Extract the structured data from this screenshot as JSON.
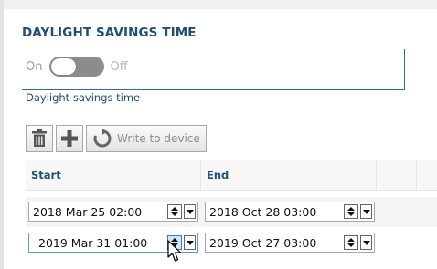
{
  "section": {
    "title": "DAYLIGHT SAVINGS TIME"
  },
  "toggle": {
    "on_label": "On",
    "off_label": "Off",
    "caption": "Daylight savings time",
    "state": "off"
  },
  "toolbar": {
    "delete_icon": "trash-icon",
    "add_icon": "plus-icon",
    "write_label": "Write to device",
    "write_icon": "sync-icon"
  },
  "table": {
    "columns": [
      "Start",
      "End"
    ],
    "rows": [
      {
        "start": "2018 Mar 25 02:00",
        "end": "2018 Oct 28 03:00"
      },
      {
        "start": "2019 Mar 31 01:00",
        "end": "2019 Oct 27 03:00"
      }
    ]
  },
  "colors": {
    "accent": "#1f4e79",
    "border_accent": "#2e6da4",
    "toggle_off": "#8c8c8c"
  }
}
